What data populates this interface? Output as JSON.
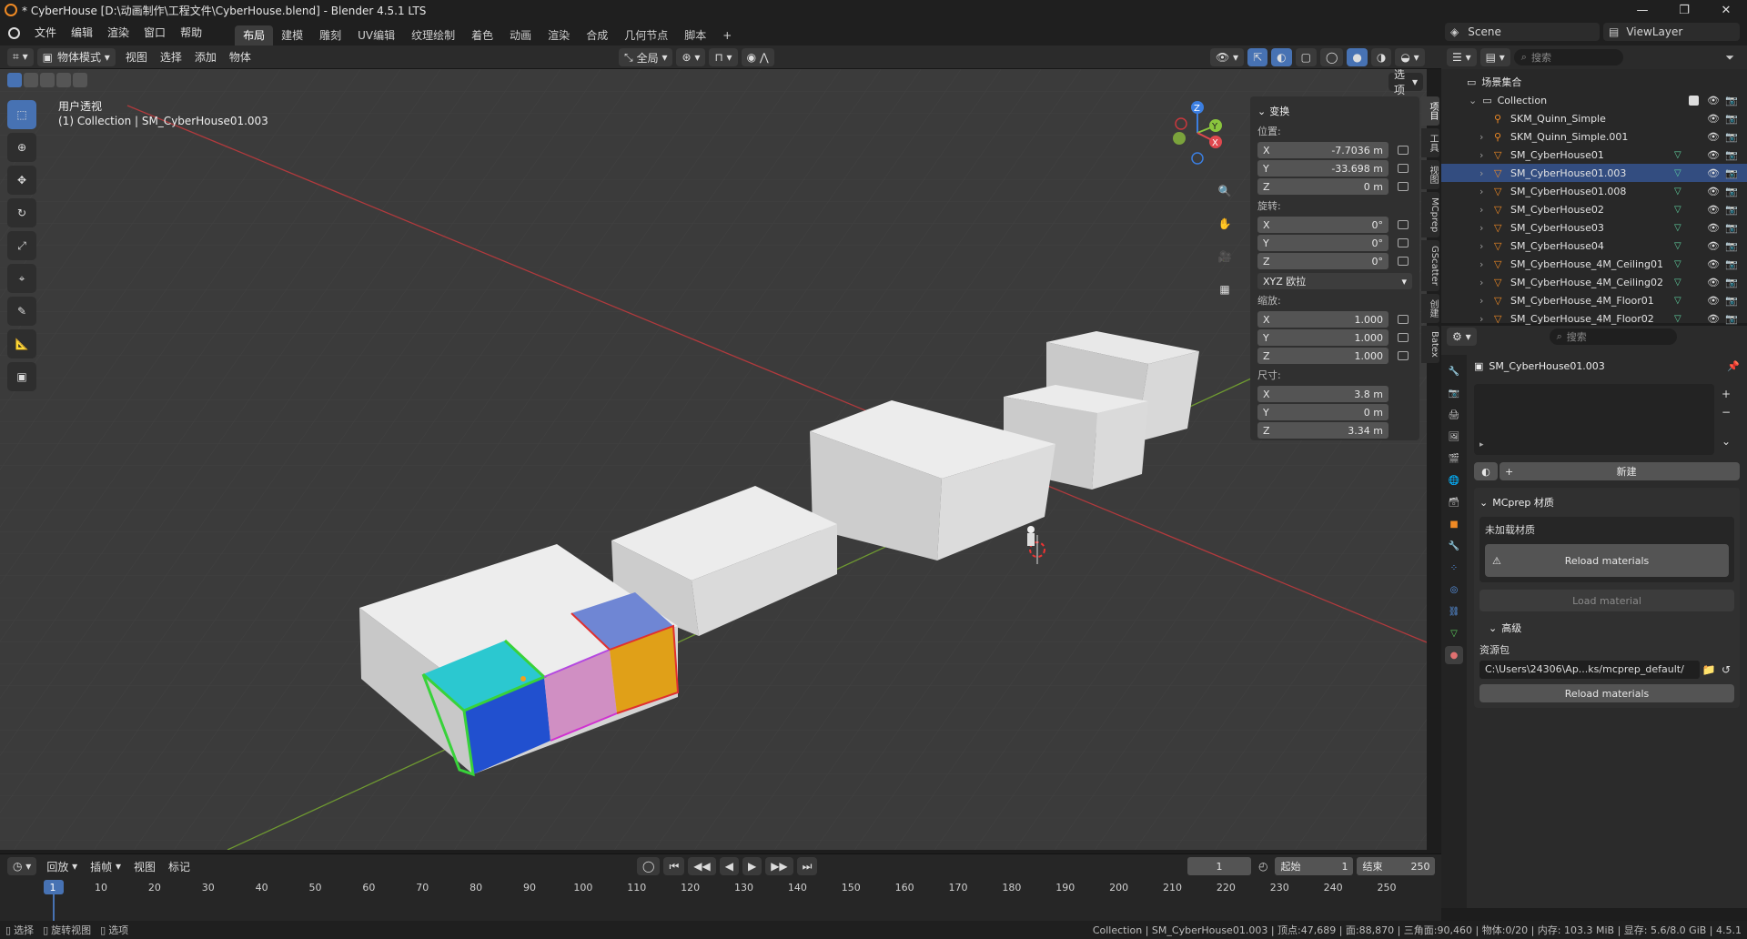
{
  "window": {
    "title": "* CyberHouse [D:\\动画制作\\工程文件\\CyberHouse.blend] - Blender 4.5.1 LTS"
  },
  "menu": [
    "文件",
    "编辑",
    "渲染",
    "窗口",
    "帮助"
  ],
  "workspaces": [
    "布局",
    "建模",
    "雕刻",
    "UV编辑",
    "纹理绘制",
    "着色",
    "动画",
    "渲染",
    "合成",
    "几何节点",
    "脚本"
  ],
  "scene": {
    "name": "Scene",
    "view_layer": "ViewLayer"
  },
  "viewport_header": {
    "mode": "物体模式",
    "menus": [
      "视图",
      "选择",
      "添加",
      "物体"
    ],
    "transform": "全局",
    "options": "选项"
  },
  "viewport": {
    "view_name": "用户透视",
    "info": "(1) Collection | SM_CyberHouse01.003"
  },
  "npanel": {
    "title": "变换",
    "location_label": "位置:",
    "location": [
      {
        "axis": "X",
        "value": "-7.7036 m"
      },
      {
        "axis": "Y",
        "value": "-33.698 m"
      },
      {
        "axis": "Z",
        "value": "0 m"
      }
    ],
    "rotation_label": "旋转:",
    "rotation": [
      {
        "axis": "X",
        "value": "0°"
      },
      {
        "axis": "Y",
        "value": "0°"
      },
      {
        "axis": "Z",
        "value": "0°"
      }
    ],
    "rotation_mode": "XYZ 欧拉",
    "scale_label": "缩放:",
    "scale": [
      {
        "axis": "X",
        "value": "1.000"
      },
      {
        "axis": "Y",
        "value": "1.000"
      },
      {
        "axis": "Z",
        "value": "1.000"
      }
    ],
    "dimensions_label": "尺寸:",
    "dimensions": [
      {
        "axis": "X",
        "value": "3.8 m"
      },
      {
        "axis": "Y",
        "value": "0 m"
      },
      {
        "axis": "Z",
        "value": "3.34 m"
      }
    ]
  },
  "side_tabs": [
    "项目",
    "工具",
    "视图",
    "MCprep",
    "GScatter",
    "创建",
    "Batex"
  ],
  "outliner": {
    "search_placeholder": "搜索",
    "scene_collection": "场景集合",
    "collection": "Collection",
    "items": [
      "SKM_Quinn_Simple",
      "SKM_Quinn_Simple.001",
      "SM_CyberHouse01",
      "SM_CyberHouse01.003",
      "SM_CyberHouse01.008",
      "SM_CyberHouse02",
      "SM_CyberHouse03",
      "SM_CyberHouse04",
      "SM_CyberHouse_4M_Ceiling01",
      "SM_CyberHouse_4M_Ceiling02",
      "SM_CyberHouse_4M_Floor01",
      "SM_CyberHouse_4M_Floor02"
    ]
  },
  "properties": {
    "search_placeholder": "搜索",
    "object_name": "SM_CyberHouse01.003",
    "new_label": "新建",
    "mcprep_title": "MCprep 材质",
    "not_loaded": "未加载材质",
    "reload_label": "Reload materials",
    "load_label": "Load material",
    "advanced_label": "高级",
    "resource_pack_label": "资源包",
    "resource_pack_path": "C:\\Users\\24306\\Ap...ks/mcprep_default/",
    "reload_label2": "Reload materials"
  },
  "timeline": {
    "menus": [
      "回放",
      "插帧",
      "视图",
      "标记"
    ],
    "current_frame": "1",
    "start_label": "起始",
    "start": "1",
    "end_label": "结束",
    "end": "250",
    "ticks": [
      "1",
      "10",
      "20",
      "30",
      "40",
      "50",
      "60",
      "70",
      "80",
      "90",
      "100",
      "110",
      "120",
      "130",
      "140",
      "150",
      "160",
      "170",
      "180",
      "190",
      "200",
      "210",
      "220",
      "230",
      "240",
      "250"
    ]
  },
  "status": {
    "left": [
      "选择",
      "旋转视图",
      "选项"
    ],
    "right": "Collection | SM_CyberHouse01.003 | 顶点:47,689 | 面:88,870 | 三角面:90,460 | 物体:0/20 | 内存: 103.3 MiB | 显存: 5.6/8.0 GiB | 4.5.1"
  },
  "colors": {
    "accent": "#4772b3",
    "selection": "#334d80",
    "x_axis": "#e0484e",
    "y_axis": "#8ac53d",
    "z_axis": "#3b7ee0"
  },
  "icons": {
    "app": "blender-icon",
    "mesh": "triangle-mesh-icon",
    "armature": "armature-icon",
    "eye": "eye-icon",
    "camera": "camera-icon"
  }
}
